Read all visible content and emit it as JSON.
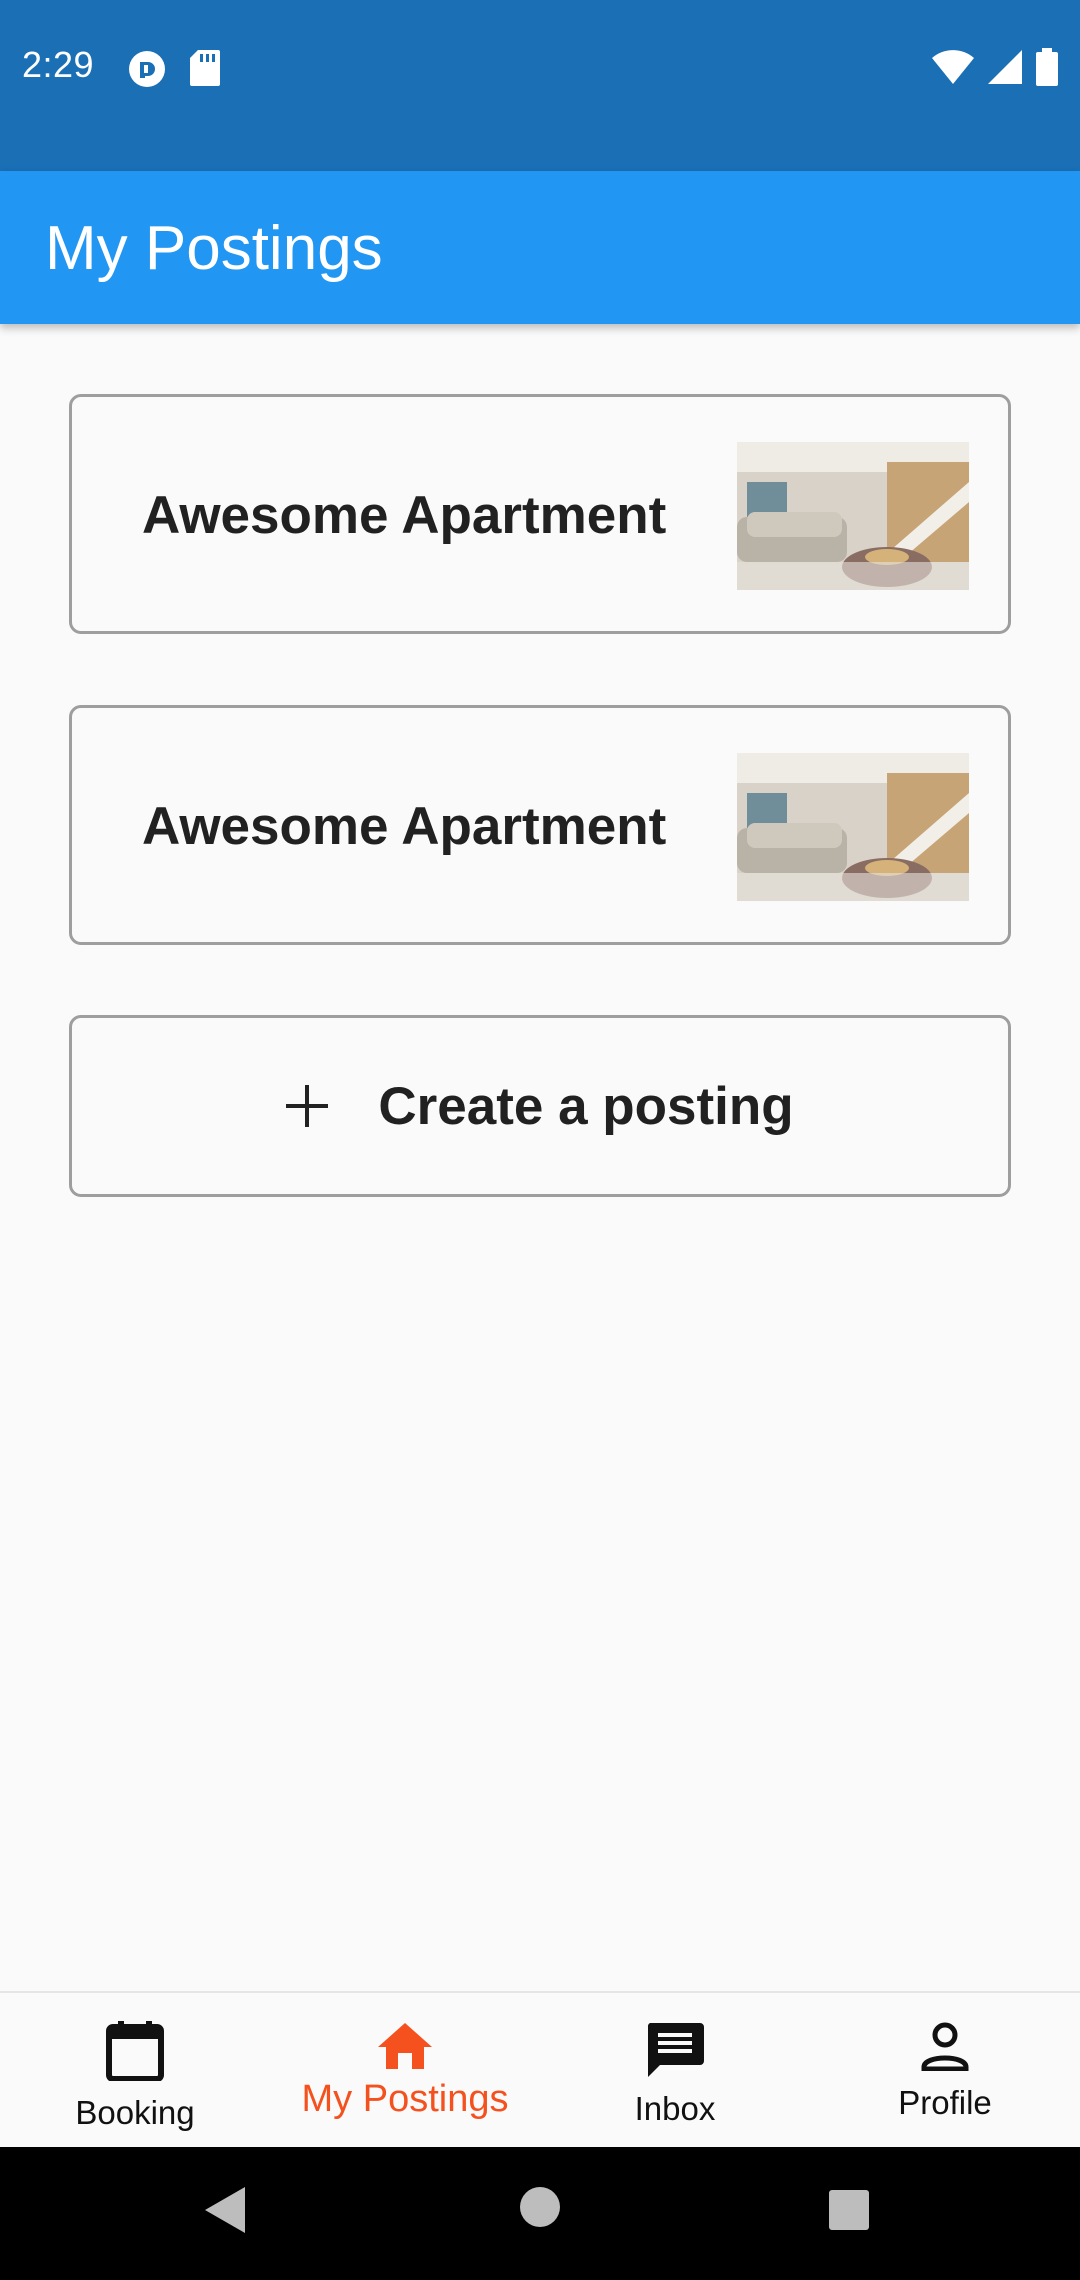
{
  "status_bar": {
    "time": "2:29",
    "left_icons": [
      "pocket-casts-icon",
      "sd-card-icon"
    ],
    "right_icons": [
      "wifi-icon",
      "cell-signal-icon",
      "battery-icon"
    ]
  },
  "app_bar": {
    "title": "My Postings"
  },
  "postings": [
    {
      "title": "Awesome Apartment",
      "image": "apartment-thumbnail"
    },
    {
      "title": "Awesome Apartment",
      "image": "apartment-thumbnail"
    }
  ],
  "create_button": {
    "label": "Create a posting",
    "icon": "plus-icon"
  },
  "bottom_nav": {
    "items": [
      {
        "label": "Booking",
        "icon": "calendar-icon",
        "active": false
      },
      {
        "label": "My Postings",
        "icon": "home-icon",
        "active": true
      },
      {
        "label": "Inbox",
        "icon": "message-icon",
        "active": false
      },
      {
        "label": "Profile",
        "icon": "person-icon",
        "active": false
      }
    ],
    "active_color": "#f4511e"
  },
  "colors": {
    "status_bar": "#1b6fb5",
    "app_bar": "#2196f3",
    "background": "#fafafa"
  }
}
